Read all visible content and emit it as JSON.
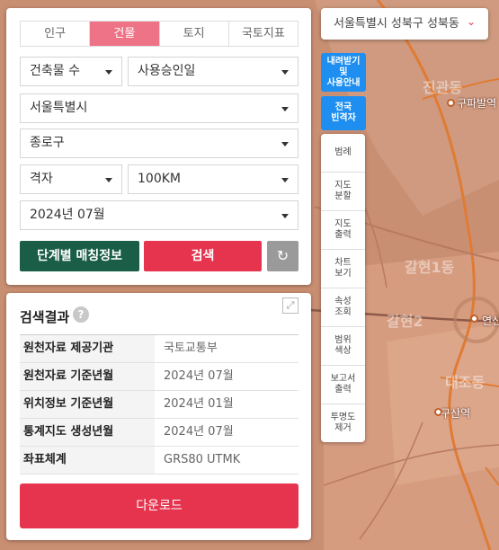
{
  "tabs": [
    "인구",
    "건물",
    "토지",
    "국토지표"
  ],
  "active_tab": "건물",
  "selects": {
    "item": "건축물 수",
    "date_type": "사용승인일",
    "sido": "서울특별시",
    "sigungu": "종로구",
    "grid": "격자",
    "grid_size": "100KM",
    "period": "2024년 07월"
  },
  "buttons": {
    "stage": "단계별 매칭정보",
    "search": "검색",
    "refresh_icon": "refresh-icon",
    "download": "다운로드"
  },
  "results": {
    "title": "검색결과",
    "help": "?",
    "rows": [
      {
        "k": "원천자료 제공기관",
        "v": "국토교통부"
      },
      {
        "k": "원천자료 기준년월",
        "v": "2024년 07월"
      },
      {
        "k": "위치정보 기준년월",
        "v": "2024년 01월"
      },
      {
        "k": "통계지도 생성년월",
        "v": "2024년 07월"
      },
      {
        "k": "좌표체계",
        "v": "GRS80 UTMK"
      }
    ]
  },
  "location": {
    "text": "서울특별시 성북구 성북동",
    "chevron": "⌄"
  },
  "side_buttons": {
    "guide": [
      "내려받기",
      "및",
      "사용안내"
    ],
    "national": [
      "전국",
      "빈격자"
    ]
  },
  "tools": [
    [
      "범례"
    ],
    [
      "지도",
      "분할"
    ],
    [
      "지도",
      "출력"
    ],
    [
      "차트",
      "보기"
    ],
    [
      "속성",
      "조회"
    ],
    [
      "범위",
      "색상"
    ],
    [
      "보고서",
      "출력"
    ],
    [
      "투명도",
      "제거"
    ]
  ],
  "map_labels": {
    "station1": "구파발역",
    "station2": "구산역",
    "partial": "연신",
    "area": "갈현1동",
    "area2": "갈현2",
    "area3": "대조동"
  },
  "colors": {
    "accent": "#ef7387",
    "search": "#e6344f",
    "stage": "#1b5e47",
    "blue": "#1e8ff0",
    "map": "#c98f73"
  }
}
